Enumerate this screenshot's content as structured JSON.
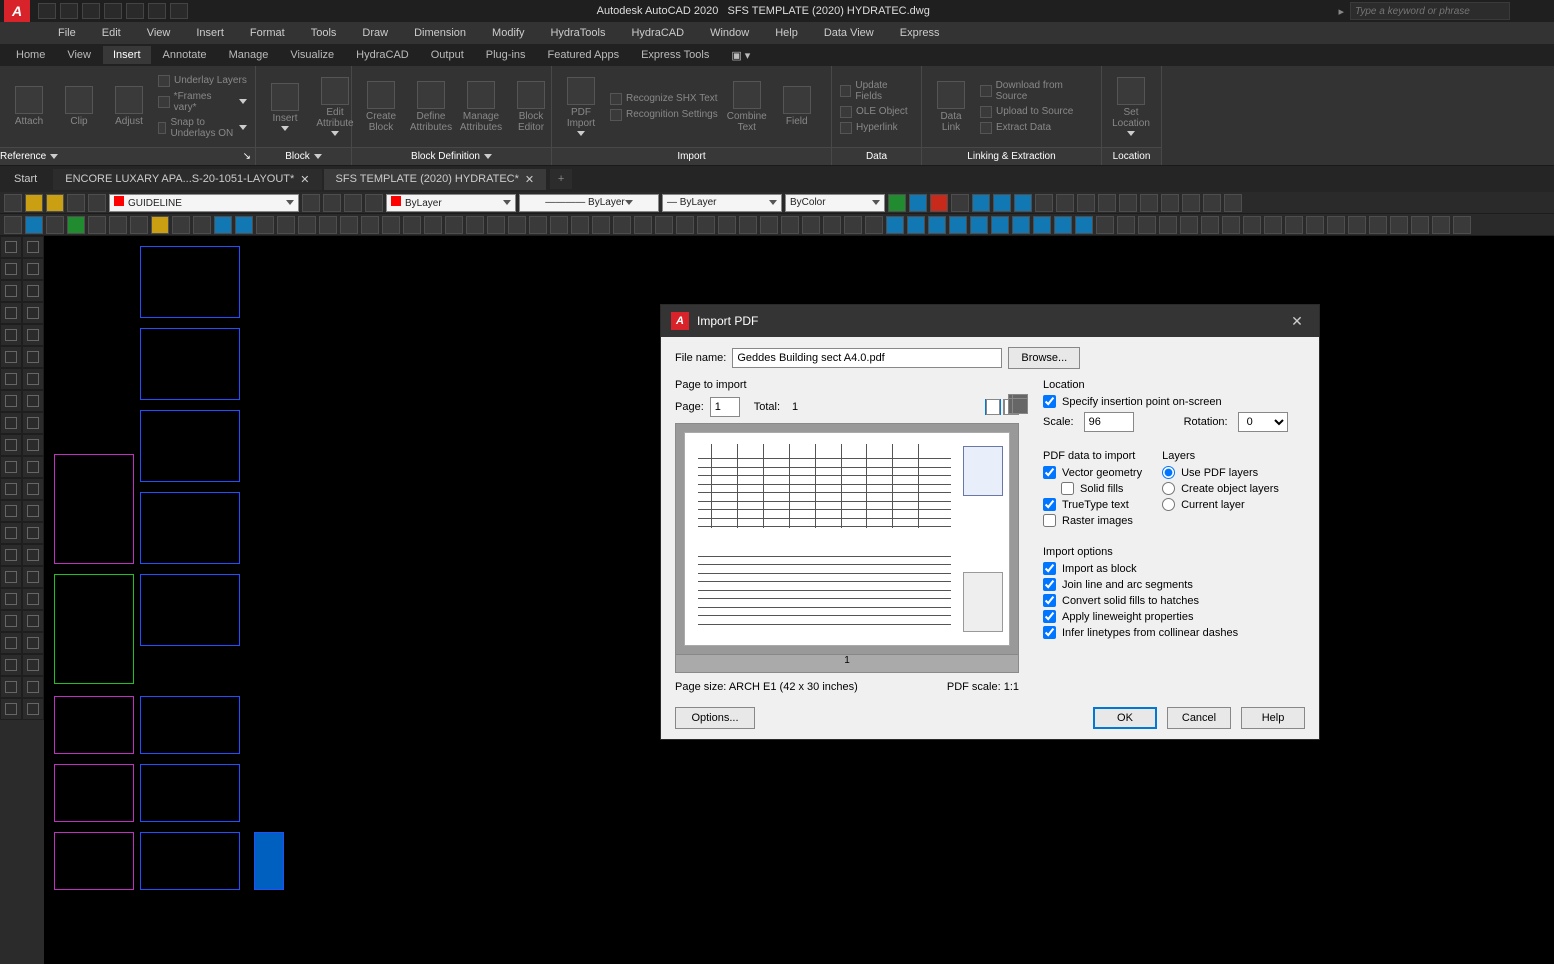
{
  "app": {
    "title_prefix": "Autodesk AutoCAD 2020",
    "title_doc": "SFS TEMPLATE (2020) HYDRATEC.dwg",
    "search_placeholder": "Type a keyword or phrase"
  },
  "menus": [
    "File",
    "Edit",
    "View",
    "Insert",
    "Format",
    "Tools",
    "Draw",
    "Dimension",
    "Modify",
    "HydraTools",
    "HydraCAD",
    "Window",
    "Help",
    "Data View",
    "Express"
  ],
  "ribbon_tabs": [
    "Home",
    "View",
    "Insert",
    "Annotate",
    "Manage",
    "Visualize",
    "HydraCAD",
    "Output",
    "Plug-ins",
    "Featured Apps",
    "Express Tools"
  ],
  "ribbon_active": "Insert",
  "ribbon": {
    "reference": {
      "title": "Reference",
      "attach": "Attach",
      "clip": "Clip",
      "adjust": "Adjust",
      "opts": [
        "Underlay Layers",
        "*Frames vary*",
        "Snap to Underlays ON"
      ]
    },
    "block": {
      "title": "Block",
      "insert": "Insert",
      "edit_attr": "Edit\nAttribute"
    },
    "blockdef": {
      "title": "Block Definition",
      "create": "Create\nBlock",
      "define": "Define\nAttributes",
      "manage": "Manage\nAttributes",
      "blockedit": "Block\nEditor"
    },
    "import": {
      "title": "Import",
      "pdf": "PDF\nImport",
      "shx": "Recognize SHX Text",
      "recog": "Recognition Settings",
      "combine": "Combine\nText",
      "field": "Field"
    },
    "data": {
      "title": "Data",
      "update": "Update Fields",
      "ole": "OLE Object",
      "hyper": "Hyperlink"
    },
    "linking": {
      "title": "Linking & Extraction",
      "datalink": "Data\nLink",
      "download": "Download from Source",
      "upload": "Upload to Source",
      "extract": "Extract  Data"
    },
    "location": {
      "title": "Location",
      "set": "Set\nLocation"
    }
  },
  "doc_tabs": {
    "start": "Start",
    "t1": "ENCORE LUXARY APA...S-20-1051-LAYOUT*",
    "t2": "SFS TEMPLATE (2020) HYDRATEC*"
  },
  "layer_combo": "GUIDELINE",
  "props": {
    "bylayer1": "ByLayer",
    "bylayer2": "ByLayer",
    "bylayer3": "ByLayer",
    "bycolor": "ByColor"
  },
  "dialog": {
    "title": "Import PDF",
    "filename_label": "File name:",
    "filename": "Geddes Building sect A4.0.pdf",
    "browse": "Browse...",
    "page_to_import": "Page to import",
    "page_label": "Page:",
    "page_value": "1",
    "total_label": "Total:",
    "total_value": "1",
    "preview_page": "1",
    "page_size": "Page size:  ARCH E1 (42 x 30 inches)",
    "pdf_scale": "PDF scale:  1:1",
    "location": "Location",
    "spec_ins": "Specify insertion point on-screen",
    "scale_label": "Scale:",
    "scale_value": "96",
    "rotation_label": "Rotation:",
    "rotation_value": "0",
    "pdf_data": "PDF data to import",
    "vector": "Vector geometry",
    "solid": "Solid fills",
    "truetype": "TrueType text",
    "raster": "Raster images",
    "layers": "Layers",
    "use_pdf": "Use PDF layers",
    "create_obj": "Create object layers",
    "current": "Current layer",
    "import_opts": "Import options",
    "as_block": "Import as block",
    "join": "Join line and arc segments",
    "convert": "Convert solid fills to hatches",
    "linew": "Apply lineweight properties",
    "infer": "Infer linetypes from collinear dashes",
    "options": "Options...",
    "ok": "OK",
    "cancel": "Cancel",
    "help": "Help"
  }
}
